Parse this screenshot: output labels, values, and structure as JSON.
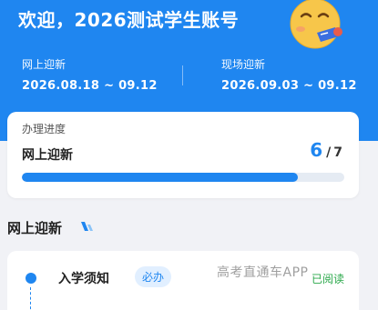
{
  "header": {
    "welcome": "欢迎，2026测试学生账号",
    "online_label": "网上迎新",
    "online_range": "2026.08.18 ~ 09.12",
    "onsite_label": "现场迎新",
    "onsite_range": "2026.09.03 ~ 09.12"
  },
  "progress": {
    "title": "办理进度",
    "stage": "网上迎新",
    "current": "6",
    "total": "7",
    "separator": "/",
    "fraction": 0.857
  },
  "section": {
    "title": "网上迎新"
  },
  "task": {
    "title": "入学须知",
    "tag": "必办",
    "status": "已阅读"
  },
  "watermark": "高考直通车APP",
  "colors": {
    "brand": "#1f86f0",
    "done": "#2aa84a"
  }
}
